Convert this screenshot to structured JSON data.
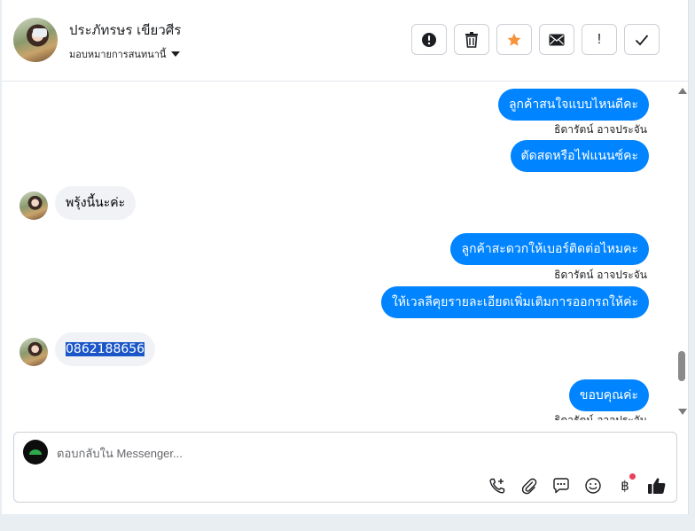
{
  "header": {
    "contact_name": "ประภัทรษร เขียวศีร",
    "assign_label": "มอบหมายการสนทนานี้",
    "actions": [
      {
        "name": "report-button",
        "icon": "alert-circle-icon"
      },
      {
        "name": "delete-button",
        "icon": "trash-icon"
      },
      {
        "name": "star-button",
        "icon": "star-icon"
      },
      {
        "name": "mark-unread-button",
        "icon": "envelope-icon"
      },
      {
        "name": "follow-up-button",
        "icon": "exclamation-icon",
        "glyph": "!"
      },
      {
        "name": "done-button",
        "icon": "check-icon"
      }
    ]
  },
  "messages": {
    "m1": "ลูกค้าสนใจแบบไหนดีคะ",
    "s1": "ธิดารัตน์ อาจประจัน",
    "m2": "ตัดสดหรือไฟแนนซ์คะ",
    "m3": "พรุ้งนี้นะค่ะ",
    "m4": "ลูกค้าสะดวกให้เบอร์ติดต่อไหมคะ",
    "s2": "ธิดารัตน์ อาจประจัน",
    "m5": "ให้เวลลีคุยรายละเอียดเพิ่มเติมการออกรถให้ค่ะ",
    "m6": "0862188656",
    "m7": "ขอบคุณค่ะ",
    "s3": "ธิดารัตน์ อาจประจัน"
  },
  "composer": {
    "placeholder": "ตอบกลับใน Messenger...",
    "tools": [
      "phone-plus-icon",
      "paperclip-icon",
      "saved-replies-icon",
      "emoji-icon",
      "baht-icon",
      "thumbs-up-icon"
    ],
    "baht_glyph": "฿"
  },
  "colors": {
    "outgoing_bubble": "#0084ff",
    "incoming_bubble": "#f0f2f5",
    "star": "#f7923a",
    "notification_dot": "#e8415b"
  }
}
